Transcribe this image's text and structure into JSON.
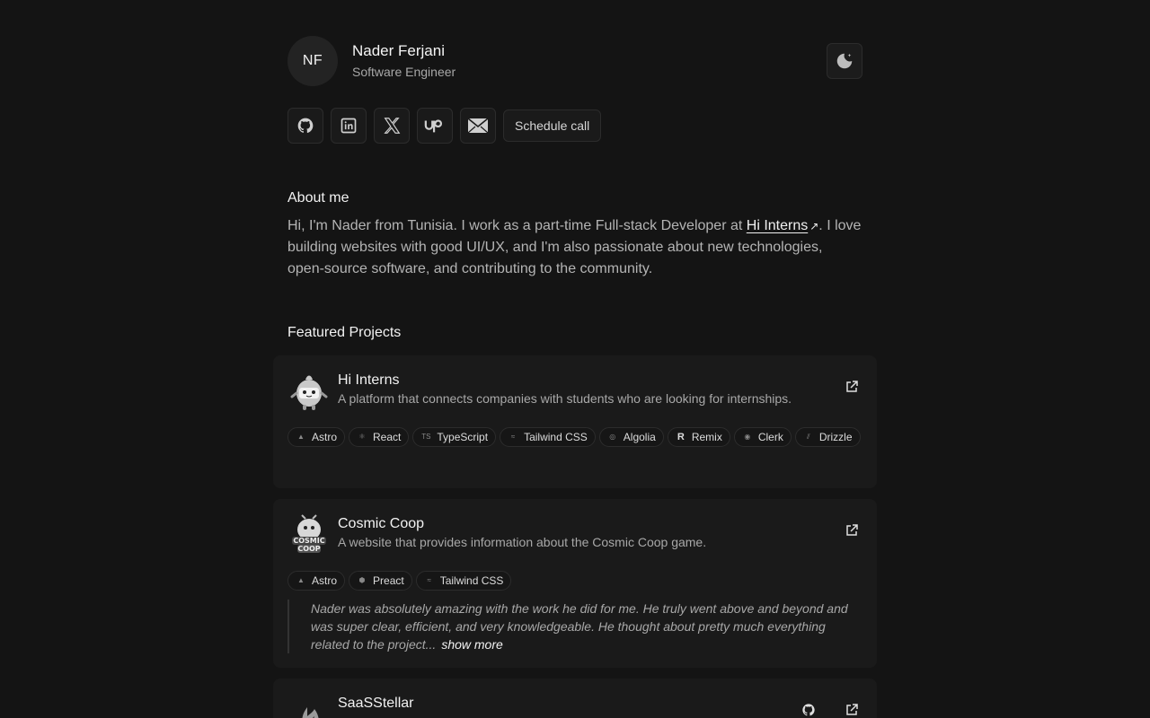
{
  "profile": {
    "initials": "NF",
    "name": "Nader Ferjani",
    "role": "Software Engineer"
  },
  "socials": {
    "items": [
      "github-icon",
      "linkedin-icon",
      "x-icon",
      "upwork-icon",
      "mail-icon"
    ],
    "schedule_label": "Schedule call"
  },
  "about": {
    "title": "About me",
    "text_before": "Hi, I'm Nader from Tunisia. I work as a part-time Full-stack Developer at ",
    "link_label": "Hi Interns",
    "text_after": ". I love building websites with good UI/UX, and I'm also passionate about new technologies, open-source software, and contributing to the community."
  },
  "featured": {
    "title": "Featured Projects",
    "projects": [
      {
        "title": "Hi Interns",
        "description": "A platform that connects companies with students who are looking for internships.",
        "tags": [
          "Astro",
          "React",
          "TypeScript",
          "Tailwind CSS",
          "Algolia",
          "Remix",
          "Clerk",
          "Drizzle"
        ]
      },
      {
        "title": "Cosmic Coop",
        "description": "A website that provides information about the Cosmic Coop game.",
        "tags": [
          "Astro",
          "Preact",
          "Tailwind CSS"
        ],
        "testimonial": "Nader was absolutely amazing with the work he did for me. He truly went above and beyond and was super clear, efficient, and very knowledgeable. He thought about pretty much everything related to the project...",
        "show_more": "show more"
      },
      {
        "title": "SaaSStellar"
      }
    ]
  },
  "colors": {
    "background": "#141414",
    "card": "#1a1a1a",
    "border": "#2c2c2c"
  }
}
